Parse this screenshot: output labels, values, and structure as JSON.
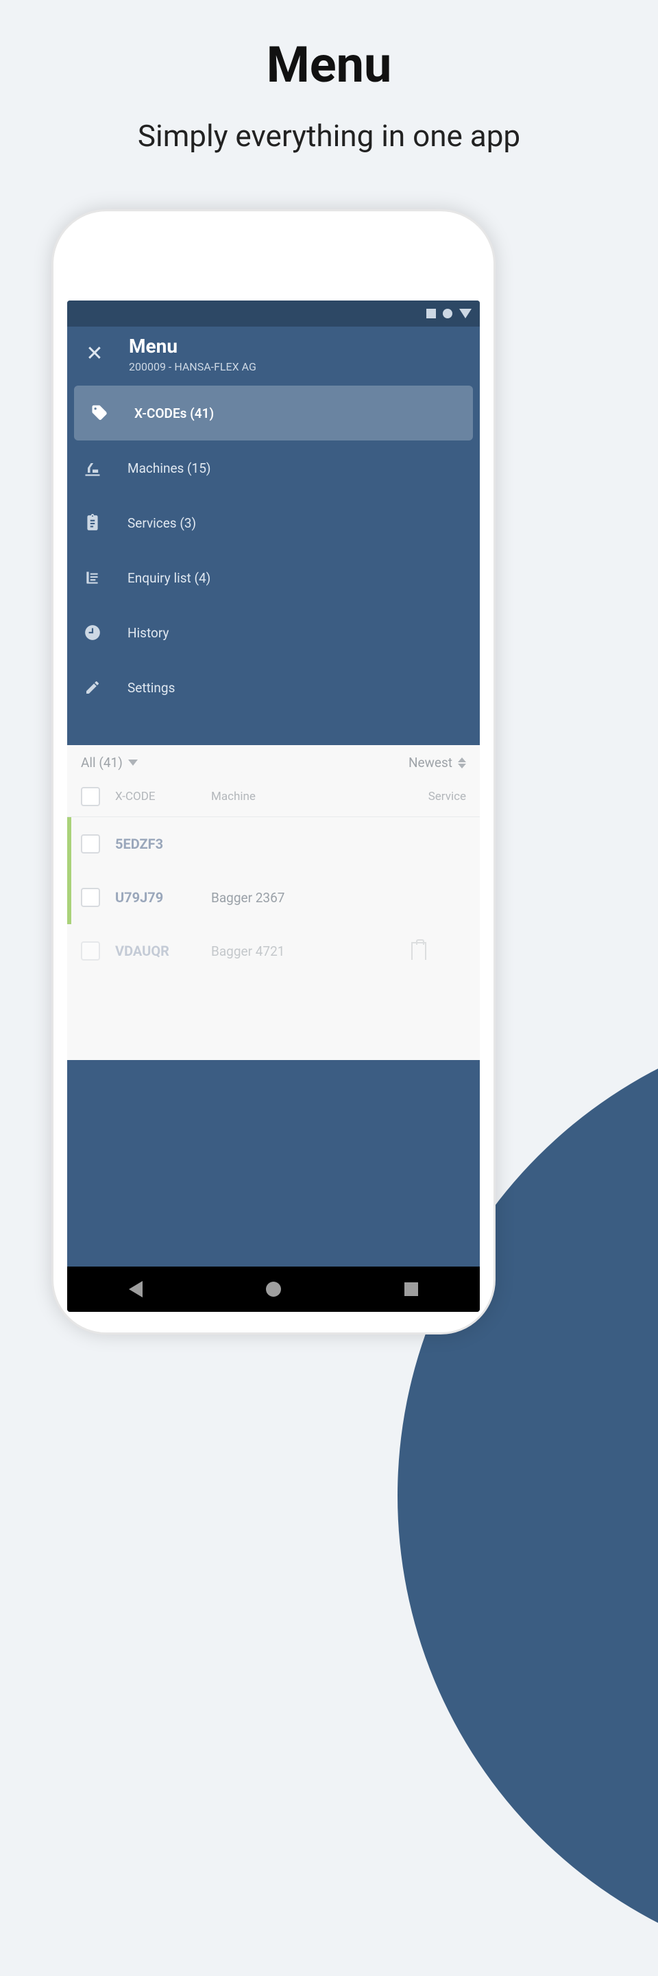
{
  "marketing": {
    "title": "Menu",
    "subtitle": "Simply everything in one app"
  },
  "drawer": {
    "title": "Menu",
    "subtitle": "200009 - HANSA-FLEX AG",
    "items": [
      {
        "label": "X-CODEs (41)",
        "icon": "tag",
        "selected": true
      },
      {
        "label": "Machines (15)",
        "icon": "machine",
        "selected": false
      },
      {
        "label": "Services (3)",
        "icon": "clipboard",
        "selected": false
      },
      {
        "label": "Enquiry list (4)",
        "icon": "cart",
        "selected": false
      },
      {
        "label": "History",
        "icon": "clock",
        "selected": false
      },
      {
        "label": "Settings",
        "icon": "pencil",
        "selected": false
      }
    ]
  },
  "content": {
    "filter_label": "All (41)",
    "sort_label": "Newest",
    "headers": {
      "code": "X-CODE",
      "machine": "Machine",
      "service": "Service"
    },
    "rows": [
      {
        "code": "5EDZF3",
        "machine": "",
        "service_icon": false
      },
      {
        "code": "U79J79",
        "machine": "Bagger 2367",
        "service_icon": false
      },
      {
        "code": "VDAUQR",
        "machine": "Bagger 4721",
        "service_icon": true
      }
    ]
  }
}
